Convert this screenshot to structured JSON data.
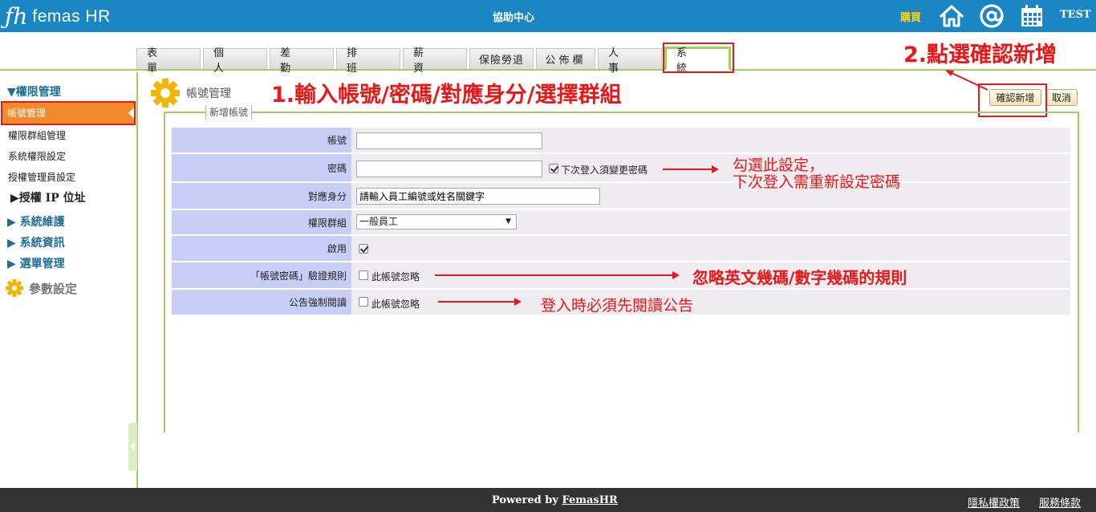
{
  "header": {
    "logo_mark": "ƒh",
    "logo_text": "femas HR",
    "center_title": "協助中心",
    "buy_label": "購買",
    "user_label": "TEST",
    "icons": [
      "home-icon",
      "at-icon",
      "calendar-icon"
    ]
  },
  "tabs": [
    {
      "label": "表 單"
    },
    {
      "label": "個 人"
    },
    {
      "label": "差 勤"
    },
    {
      "label": "排 班"
    },
    {
      "label": "薪 資"
    },
    {
      "label": "保險勞退"
    },
    {
      "label": "公佈欄"
    },
    {
      "label": "人 事"
    },
    {
      "label": "系 統",
      "active": true
    }
  ],
  "sidebar": {
    "section_permission": "▼權限管理",
    "active_item": "帳號管理",
    "items": [
      "權限群組管理",
      "系統權限設定",
      "授權管理員設定"
    ],
    "sub_ip": "▶授權 IP 位址",
    "section_maintenance": "▶ 系統維護",
    "section_info": "▶ 系統資訊",
    "section_menu": "▶ 選單管理",
    "param_settings": "參數設定"
  },
  "page": {
    "title": "帳號管理",
    "legend": "新增帳號",
    "confirm_button": "確認新增",
    "cancel_button": "取消"
  },
  "form": {
    "account_label": "帳號",
    "account_value": "",
    "password_label": "密碼",
    "password_value": "",
    "password_change_checked": true,
    "password_change_text": "下次登入須變更密碼",
    "identity_label": "對應身分",
    "identity_placeholder": "請輸入員工編號或姓名關鍵字",
    "group_label": "權限群組",
    "group_selected": "一般員工",
    "enable_label": "啟用",
    "enable_checked": true,
    "rule_label": "「帳號密碼」驗證規則",
    "rule_ignore_checked": false,
    "rule_ignore_text": "此帳號忽略",
    "announce_label": "公告強制閱讀",
    "announce_ignore_checked": false,
    "announce_ignore_text": "此帳號忽略"
  },
  "annotations": {
    "step1": "1.輸入帳號/密碼/對應身分/選擇群組",
    "step2": "2.點選確認新增",
    "password_note_line1": "勾選此設定，",
    "password_note_line2": "下次登入需重新設定密碼",
    "rule_note": "忽略英文幾碼/數字幾碼的規則",
    "announce_note": "登入時必須先閱讀公告"
  },
  "footer": {
    "powered_prefix": "Powered by ",
    "powered_link": "FemasHR",
    "privacy_link": "隱私權政策",
    "terms_link": "服務條款"
  },
  "colors": {
    "header_bg": "#1a87c4",
    "accent_green": "#9dcf63",
    "active_orange": "#f08a2c",
    "annotation_red": "#e81818",
    "label_bg": "#c7cdf5"
  }
}
